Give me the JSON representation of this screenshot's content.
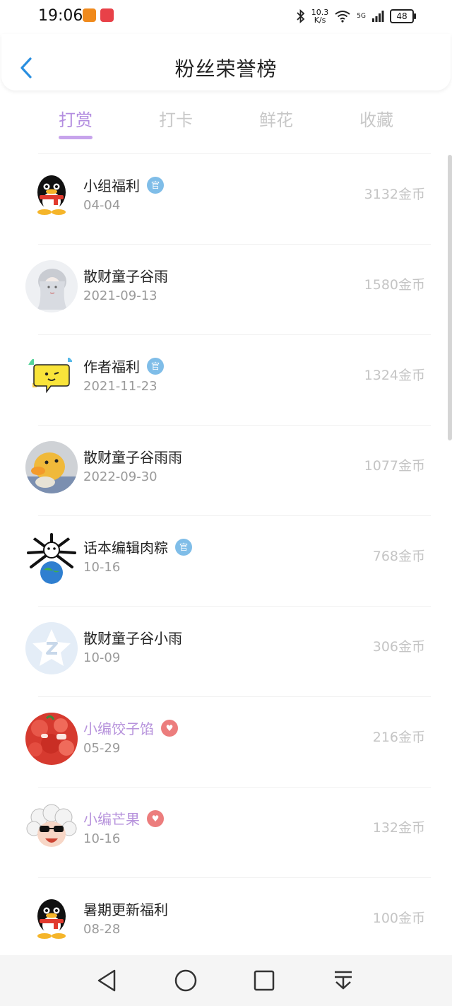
{
  "status_bar": {
    "time": "19:06",
    "speed_value": "10.3",
    "speed_unit": "K/s",
    "network": "5G",
    "battery": "48"
  },
  "header": {
    "title": "粉丝荣誉榜"
  },
  "tabs": [
    {
      "label": "打赏",
      "active": true
    },
    {
      "label": "打卡",
      "active": false
    },
    {
      "label": "鲜花",
      "active": false
    },
    {
      "label": "收藏",
      "active": false
    }
  ],
  "rows": [
    {
      "name": "小组福利",
      "date": "04-04",
      "coins": "3132金币",
      "badge": "官",
      "badge_type": "official",
      "avatar": "penguin-avatar"
    },
    {
      "name": "散财童子谷雨",
      "date": "2021-09-13",
      "coins": "1580金币",
      "badge": "",
      "badge_type": "",
      "avatar": "anime-girl-avatar"
    },
    {
      "name": "作者福利",
      "date": "2021-11-23",
      "coins": "1324金币",
      "badge": "官",
      "badge_type": "official",
      "avatar": "chat-bubble-avatar"
    },
    {
      "name": "散财童子谷雨雨",
      "date": "2022-09-30",
      "coins": "1077金币",
      "badge": "",
      "badge_type": "",
      "avatar": "yellow-duck-avatar"
    },
    {
      "name": "话本编辑肉粽",
      "date": "10-16",
      "coins": "768金币",
      "badge": "官",
      "badge_type": "official",
      "avatar": "cartoon-earth-avatar"
    },
    {
      "name": "散财童子谷小雨",
      "date": "10-09",
      "coins": "306金币",
      "badge": "",
      "badge_type": "",
      "avatar": "default-avatar"
    },
    {
      "name": "小编饺子馅",
      "date": "05-29",
      "coins": "216金币",
      "badge": "♥",
      "badge_type": "editor",
      "avatar": "strawberry-avatar"
    },
    {
      "name": "小编芒果",
      "date": "10-16",
      "coins": "132金币",
      "badge": "♥",
      "badge_type": "editor",
      "avatar": "sheep-sunglasses-avatar"
    },
    {
      "name": "暑期更新福利",
      "date": "08-28",
      "coins": "100金币",
      "badge": "",
      "badge_type": "",
      "avatar": "penguin-avatar"
    }
  ],
  "colors": {
    "accent": "#b38de0",
    "official_badge": "#7fbde8",
    "editor_badge": "#ec7d7d"
  },
  "icons": {
    "back": "chevron-left-icon",
    "nav_back": "triangle-back-icon",
    "nav_home": "circle-home-icon",
    "nav_recent": "square-recent-icon",
    "nav_menu": "pull-down-icon"
  }
}
